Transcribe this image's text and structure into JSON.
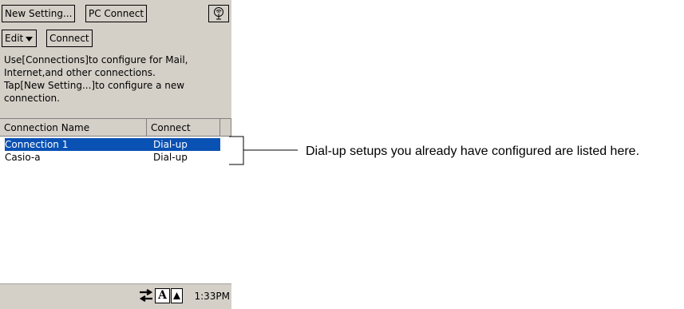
{
  "toolbar": {
    "new_setting_label": "New Setting...",
    "pc_connect_label": "PC Connect",
    "edit_label": "Edit",
    "connect_label": "Connect"
  },
  "description": {
    "line1": "Use[Connections]to configure for Mail,",
    "line2": "Internet,and other connections.",
    "line3": "Tap[New Setting...]to configure a new",
    "line4": "connection."
  },
  "list": {
    "headers": [
      "Connection Name",
      "Connect"
    ],
    "rows": [
      {
        "name": "Connection 1",
        "connect": "Dial-up",
        "selected": true
      },
      {
        "name": "Casio-a",
        "connect": "Dial-up",
        "selected": false
      }
    ]
  },
  "taskbar": {
    "input_label": "A",
    "time": "1:33PM"
  },
  "callout": {
    "text": "Dial-up setups you already have configured are listed here."
  },
  "colors": {
    "selection": "#0a51b4",
    "chrome": "#d4d0c8"
  }
}
